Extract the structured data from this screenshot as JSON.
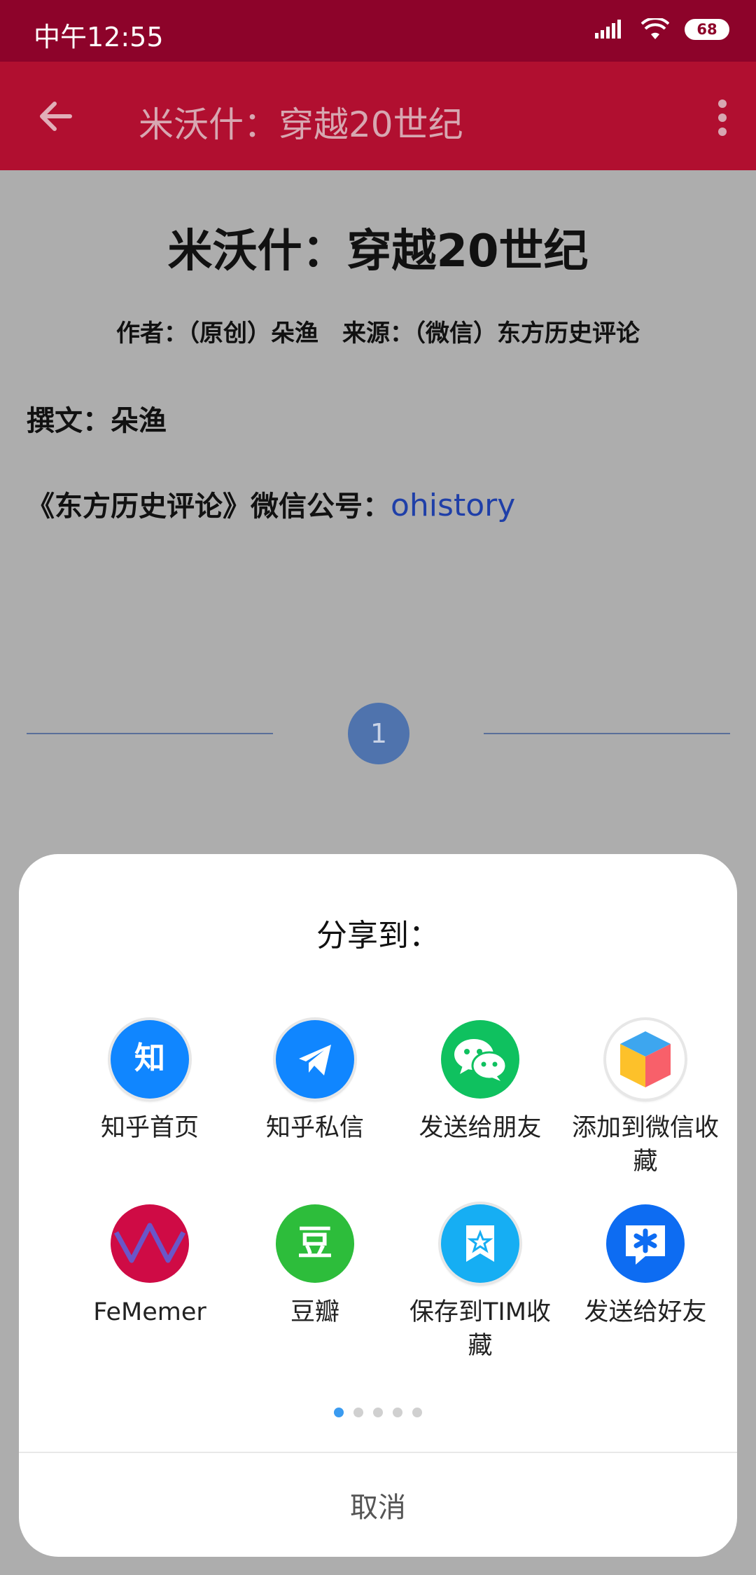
{
  "status_bar": {
    "time": "中午12:55",
    "battery": "68"
  },
  "app_bar": {
    "title": "米沃什：穿越20世纪"
  },
  "article": {
    "title": "米沃什：穿越20世纪",
    "meta": "作者：（原创）朵渔　来源：（微信）东方历史评论",
    "line1": "撰文：朵渔",
    "line2_prefix": "《东方历史评论》微信公号：",
    "line2_link": "ohistory",
    "page_number": "1"
  },
  "share_sheet": {
    "title": "分享到：",
    "items": [
      {
        "label": "知乎首页",
        "icon": "zhihu-icon"
      },
      {
        "label": "知乎私信",
        "icon": "zhihu-message-icon"
      },
      {
        "label": "发送给朋友",
        "icon": "wechat-icon"
      },
      {
        "label": "添加到微信收藏",
        "icon": "wechat-favorite-icon"
      },
      {
        "label": "FeMemer",
        "icon": "femember-icon"
      },
      {
        "label": "豆瓣",
        "icon": "douban-icon"
      },
      {
        "label": "保存到TIM收藏",
        "icon": "tim-favorite-icon"
      },
      {
        "label": "发送给好友",
        "icon": "tim-icon"
      }
    ],
    "page_dots": 5,
    "active_dot": 0,
    "cancel_label": "取消"
  },
  "colors": {
    "status_bar": "#8d032a",
    "app_bar": "#b10f30",
    "scrim": "#adadad",
    "link": "#1f3fa8",
    "active_dot": "#3a9bf0"
  }
}
